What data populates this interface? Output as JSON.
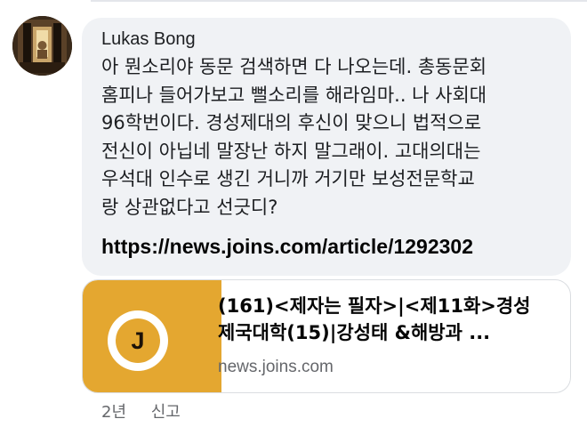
{
  "comment": {
    "author": "Lukas Bong",
    "text": "아 뭔소리야 동문 검색하면 다 나오는데. 총동문회\n홈피나 들어가보고 뻘소리를 해라임마.. 나 사회대\n96학번이다. 경성제대의 후신이 맞으니 법적으로\n전신이 아닙네 말장난 하지 말그래이. 고대의대는\n우석대 인수로 생긴 거니까 거기만 보성전문학교\n랑 상관없다고 선긋디?",
    "link": "https://news.joins.com/article/1292302"
  },
  "link_preview": {
    "thumbnail_letter": "J",
    "thumbnail_color": "#e4a730",
    "title": "(161)<제자는 필자>|<제11화>경성\n제국대학(15)|강성태 &해방과 ...",
    "domain": "news.joins.com"
  },
  "meta": {
    "time": "2년",
    "report_label": "신고"
  },
  "colors": {
    "bubble_bg": "#f0f2f5",
    "secondary_text": "#65676b"
  }
}
